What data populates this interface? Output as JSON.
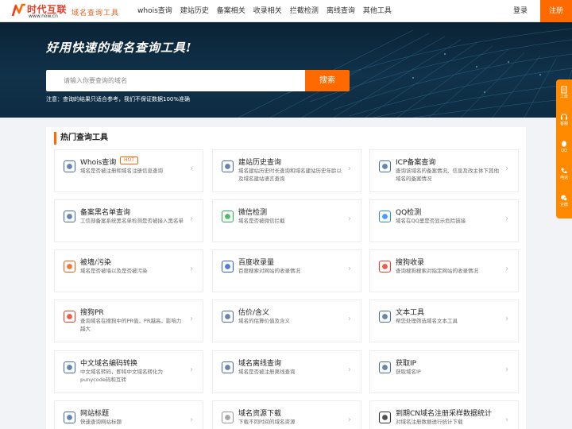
{
  "header": {
    "logo_cn": "时代互联",
    "logo_url": "www.now.cn",
    "slogan": "域名查询工具",
    "nav": [
      "whois查询",
      "建站历史",
      "备案相关",
      "收录相关",
      "拦截检测",
      "离线查询",
      "其他工具"
    ],
    "login": "登录",
    "register": "注册"
  },
  "hero": {
    "title": "好用快速的域名查询工具!",
    "search_placeholder": "请输入你要查询的域名",
    "search_button": "搜索",
    "note": "注意：查询的结果只适合参考，我们不保证数据100%准确"
  },
  "side": {
    "items": [
      {
        "label": "工单",
        "icon": "ticket-icon"
      },
      {
        "label": "客服",
        "icon": "headset-icon"
      },
      {
        "label": "QQ",
        "icon": "qq-icon"
      },
      {
        "label": "电话",
        "icon": "phone-icon"
      },
      {
        "label": "企微",
        "icon": "wecom-icon"
      }
    ]
  },
  "section": {
    "title": "热门查询工具",
    "hot_badge": "HOT",
    "tools": [
      {
        "title": "Whois查询",
        "desc": "域名是否被注册和域名注册信息查询",
        "icon": "whois-icon",
        "color": "#4a6fa5"
      },
      {
        "title": "建站历史查询",
        "desc": "域名建站历史时长查询和域名建站历史年龄以及域名建站语言查询",
        "icon": "history-icon",
        "color": "#4a6fa5"
      },
      {
        "title": "ICP备案查询",
        "desc": "查询该域名的备案情况、信息及改主体下其他域名的备案情况",
        "icon": "icp-icon",
        "color": "#4a6fa5"
      },
      {
        "title": "备案黑名单查询",
        "desc": "工信部备案系统黑名单检测是否被接入黑名单",
        "icon": "blacklist-icon",
        "color": "#4a6fa5"
      },
      {
        "title": "微信检测",
        "desc": "域名是否被微信拦截",
        "icon": "wechat-icon",
        "color": "#2bb24c"
      },
      {
        "title": "QQ检测",
        "desc": "域名在QQ里是否显示危险链接",
        "icon": "qq-check-icon",
        "color": "#2d8cf0"
      },
      {
        "title": "被墙/污染",
        "desc": "域名是否被墙以及是否被污染",
        "icon": "firewall-icon",
        "color": "#e8621a"
      },
      {
        "title": "百度收录量",
        "desc": "百度搜索对网站的收录情况",
        "icon": "baidu-icon",
        "color": "#2d65d8"
      },
      {
        "title": "搜狗收录",
        "desc": "查询搜狗搜索对指定网站的收录情况",
        "icon": "sogou-icon",
        "color": "#e8402b"
      },
      {
        "title": "搜狗PR",
        "desc": "查询域名在搜狗中的PR值，PR越高，影响力越大",
        "icon": "sogou-pr-icon",
        "color": "#e8402b"
      },
      {
        "title": "估价/含义",
        "desc": "域名的估算价值及含义",
        "icon": "valuation-icon",
        "color": "#4a6fa5"
      },
      {
        "title": "文本工具",
        "desc": "帮您处理筛选域名文本工具",
        "icon": "text-tool-icon",
        "color": "#4a6fa5"
      },
      {
        "title": "中文域名编码转换",
        "desc": "中文域名转码，即将中文域名转化为punycode码和互转",
        "icon": "encode-icon",
        "color": "#4a6fa5"
      },
      {
        "title": "域名离线查询",
        "desc": "域名是否被注册离线查询",
        "icon": "www-icon",
        "color": "#4a6fa5"
      },
      {
        "title": "获取IP",
        "desc": "获取域名IP",
        "icon": "ip-icon",
        "color": "#4a6fa5"
      },
      {
        "title": "网站标题",
        "desc": "快速查询网站标题",
        "icon": "title-icon",
        "color": "#4a6fa5"
      },
      {
        "title": "域名资源下载",
        "desc": "下载不同时间的域名资源",
        "icon": "download-icon",
        "color": "#999999"
      },
      {
        "title": "到期CN域名注册采样数据统计",
        "desc": "对域名注册数据进行统计下载",
        "icon": "database-icon",
        "color": "#333333"
      }
    ]
  }
}
